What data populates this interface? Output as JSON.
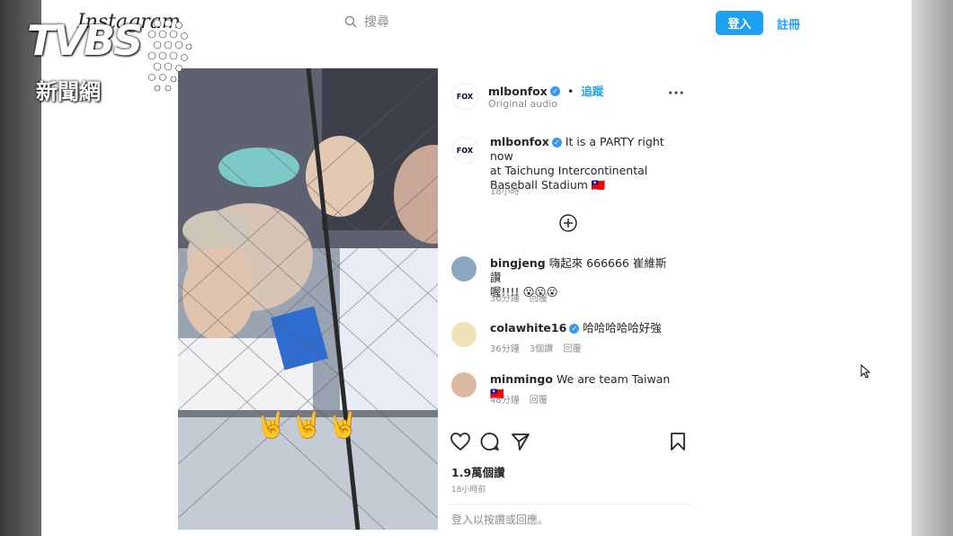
{
  "header": {
    "logo_text": "Instagram",
    "search_placeholder": "搜尋",
    "login_label": "登入",
    "signup_label": "註冊"
  },
  "watermark": {
    "brand": "TVBS",
    "subtitle": "新聞網"
  },
  "post": {
    "author": "mlbonfox",
    "follow_label": "追蹤",
    "audio": "Original audio",
    "caption_author": "mlbonfox",
    "caption_line1": "It is a PARTY right now",
    "caption_line2": "at Taichung Intercontinental",
    "caption_line3": "Baseball Stadium 🇹🇼",
    "caption_time": "18小時",
    "video_emojis": [
      "🤘",
      "🤘",
      "🤘"
    ]
  },
  "comments": [
    {
      "user": "bingjeng",
      "verified": false,
      "text_line1": "嗨起來 666666 崔維斯 讚",
      "text_line2": "喔!!!! 😮😮😮",
      "time": "36分鐘",
      "likes": "",
      "reply": "回覆"
    },
    {
      "user": "colawhite16",
      "verified": true,
      "text_line1": "哈哈哈哈哈好強",
      "text_line2": "",
      "time": "36分鐘",
      "likes": "3個讚",
      "reply": "回覆"
    },
    {
      "user": "minmingo",
      "verified": false,
      "text_line1": "We are team Taiwan🇹🇼",
      "text_line2": "",
      "time": "48分鐘",
      "likes": "",
      "reply": "回覆"
    }
  ],
  "actions": {
    "like_icon": "heart-icon",
    "comment_icon": "comment-icon",
    "share_icon": "paper-plane-icon",
    "save_icon": "bookmark-icon"
  },
  "stats": {
    "views": "1.9萬個讚",
    "time": "18小時前"
  },
  "footer": {
    "login_prompt": "登入以按讚或回應。"
  },
  "colors": {
    "accent": "#1fa1f1",
    "verified": "#3897f0"
  }
}
